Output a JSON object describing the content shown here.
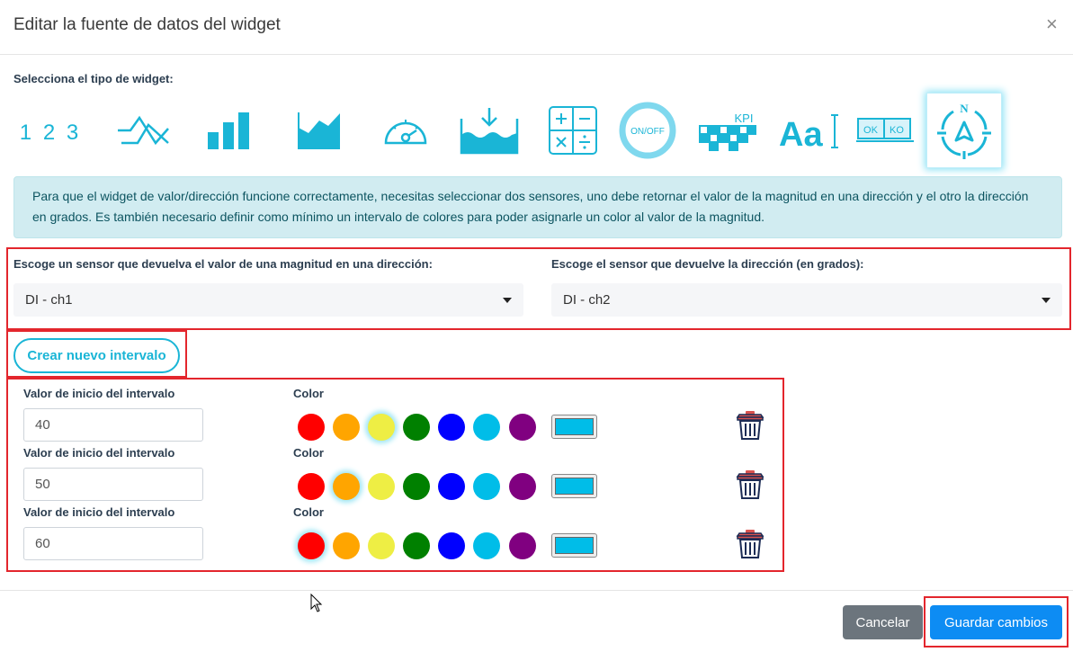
{
  "dialog": {
    "title": "Editar la fuente de datos del widget",
    "close_symbol": "×"
  },
  "widget_section": {
    "label": "Selecciona el tipo de widget:",
    "types": [
      {
        "icon": "numeric-icon",
        "text": "1 2 3"
      },
      {
        "icon": "line-chart-icon"
      },
      {
        "icon": "bar-chart-icon"
      },
      {
        "icon": "area-chart-icon"
      },
      {
        "icon": "gauge-icon"
      },
      {
        "icon": "tank-level-icon"
      },
      {
        "icon": "calculator-icon"
      },
      {
        "icon": "on-off-icon",
        "text": "ON/OFF"
      },
      {
        "icon": "kpi-icon",
        "text": "KPI"
      },
      {
        "icon": "text-icon",
        "text": "Aa"
      },
      {
        "icon": "ok-ko-icon",
        "text_ok": "OK",
        "text_ko": "KO"
      },
      {
        "icon": "compass-icon",
        "text": "N",
        "selected": true
      }
    ]
  },
  "info": {
    "text": "Para que el widget de valor/dirección funcione correctamente, necesitas seleccionar dos sensores, uno debe retornar el valor de la magnitud en una dirección y el otro la dirección en grados. Es también necesario definir como mínimo un intervalo de colores para poder asignarle un color al valor de la magnitud."
  },
  "sensors": {
    "magnitude_label": "Escoge un sensor que devuelva el valor de una magnitud en una dirección:",
    "magnitude_value": "DI - ch1",
    "direction_label": "Escoge el sensor que devuelve la dirección (en grados):",
    "direction_value": "DI - ch2"
  },
  "new_interval_label": "Crear nuevo intervalo",
  "palette": [
    "#ff0000",
    "#ffa500",
    "#eeee44",
    "#008000",
    "#0000ff",
    "#00bde8",
    "#800080"
  ],
  "intervals": [
    {
      "label": "Valor de inicio del intervalo",
      "color_label": "Color",
      "value": "40",
      "selected_color_index": 2,
      "preview_color": "#00bde8"
    },
    {
      "label": "Valor de inicio del intervalo",
      "color_label": "Color",
      "value": "50",
      "selected_color_index": 1,
      "preview_color": "#00bde8"
    },
    {
      "label": "Valor de inicio del intervalo",
      "color_label": "Color",
      "value": "60",
      "selected_color_index": 0,
      "preview_color": "#00bde8"
    }
  ],
  "footer": {
    "cancel_label": "Cancelar",
    "save_label": "Guardar cambios"
  },
  "colors": {
    "accent": "#1ab5d6",
    "primary": "#0d8cf3",
    "highlight_outline": "#e3262d"
  }
}
